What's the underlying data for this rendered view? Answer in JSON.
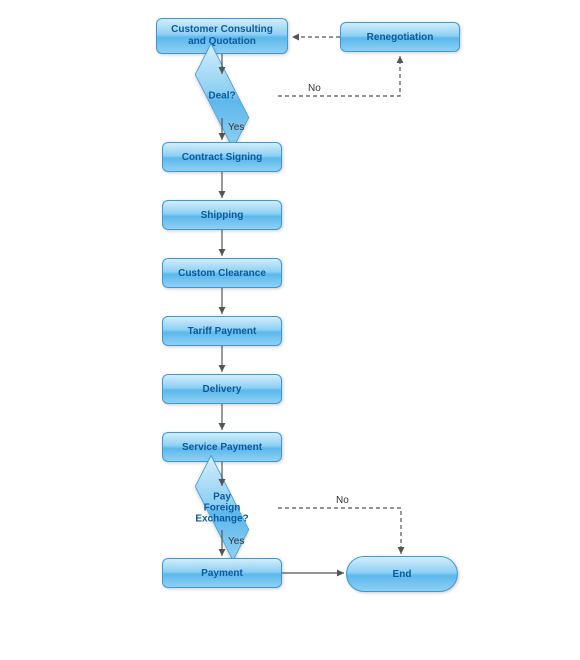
{
  "nodes": {
    "start": "Customer Consulting\nand Quotation",
    "deal": "Deal?",
    "reneg": "Renegotiation",
    "contract": "Contract Signing",
    "shipping": "Shipping",
    "customs": "Custom Clearance",
    "tariff": "Tariff Payment",
    "delivery": "Delivery",
    "service": "Service Payment",
    "foreign": "Pay Foreign\nExchange?",
    "payment": "Payment",
    "end": "End"
  },
  "labels": {
    "yes1": "Yes",
    "no1": "No",
    "yes2": "Yes",
    "no2": "No"
  }
}
